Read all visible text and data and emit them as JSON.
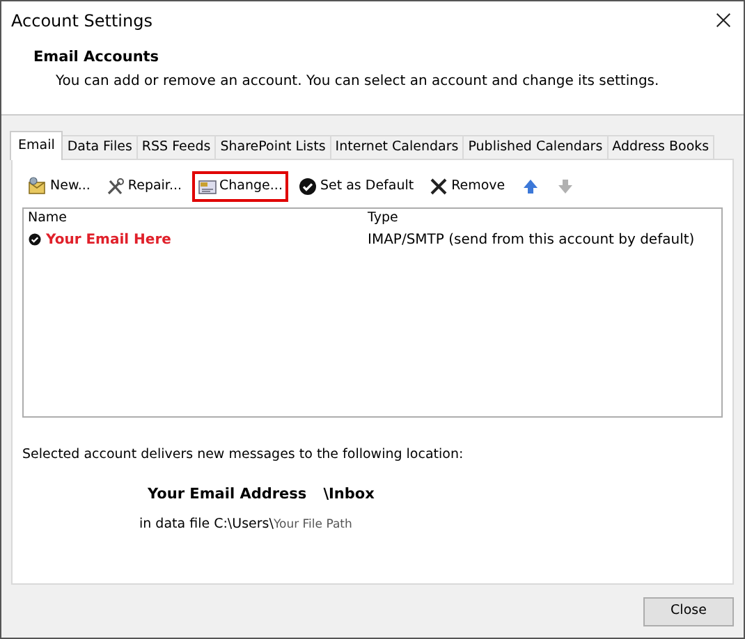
{
  "window": {
    "title": "Account Settings"
  },
  "header": {
    "title": "Email Accounts",
    "description": "You can add or remove an account. You can select an account and change its settings."
  },
  "tabs": [
    {
      "label": "Email",
      "selected": true
    },
    {
      "label": "Data Files",
      "selected": false
    },
    {
      "label": "RSS Feeds",
      "selected": false
    },
    {
      "label": "SharePoint Lists",
      "selected": false
    },
    {
      "label": "Internet Calendars",
      "selected": false
    },
    {
      "label": "Published Calendars",
      "selected": false
    },
    {
      "label": "Address Books",
      "selected": false
    }
  ],
  "toolbar": [
    {
      "kind": "new",
      "label": "New...",
      "highlighted": false,
      "disabled": false
    },
    {
      "kind": "repair",
      "label": "Repair...",
      "highlighted": false,
      "disabled": false
    },
    {
      "kind": "change",
      "label": "Change...",
      "highlighted": true,
      "disabled": false
    },
    {
      "kind": "default",
      "label": "Set as Default",
      "highlighted": false,
      "disabled": false
    },
    {
      "kind": "remove",
      "label": "Remove",
      "highlighted": false,
      "disabled": false
    },
    {
      "kind": "up",
      "highlighted": false,
      "disabled": false
    },
    {
      "kind": "down",
      "highlighted": false,
      "disabled": true
    }
  ],
  "table": {
    "columns": [
      "Name",
      "Type"
    ],
    "rows": [
      {
        "name": "Your Email Here",
        "type": "IMAP/SMTP (send from this account by default)",
        "default": true
      }
    ]
  },
  "location": {
    "intro": "Selected account delivers new messages to the following location:",
    "account": "Your Email Address",
    "folder": "\\Inbox",
    "file_prefix": "in data file C:\\Users\\",
    "file_path": "Your File Path"
  },
  "buttons": [
    "Close"
  ]
}
